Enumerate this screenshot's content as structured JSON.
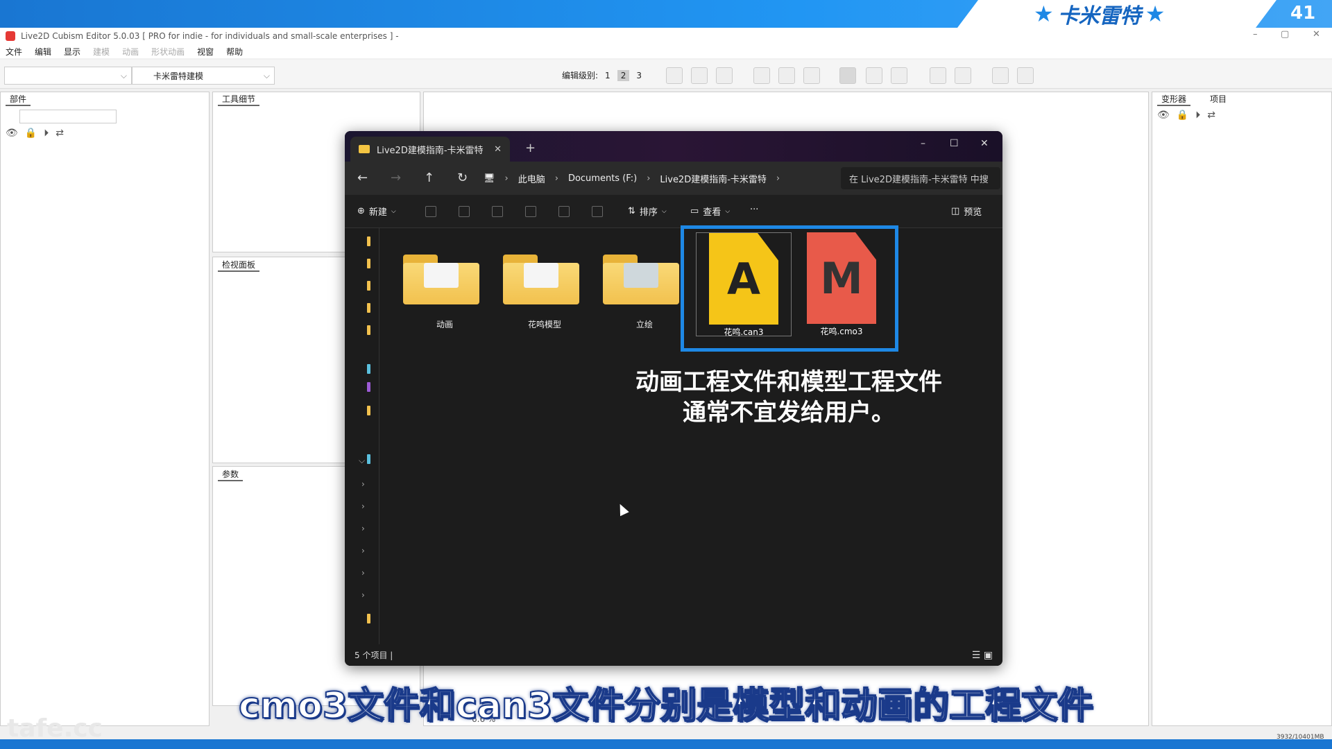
{
  "banner": {
    "brand": "卡米雷特",
    "star": "★",
    "episode": "41"
  },
  "titlebar": {
    "title": "Live2D Cubism Editor 5.0.03   [ PRO for indie - for individuals and small-scale enterprises ]  -",
    "minimize": "–",
    "maximize": "▢",
    "close": "✕"
  },
  "menu": {
    "file": "文件",
    "edit": "编辑",
    "view": "显示",
    "modeling": "建模",
    "animation": "动画",
    "form_anim": "形状动画",
    "window": "视窗",
    "help": "帮助"
  },
  "toolbar": {
    "workspace": "卡米雷特建模",
    "edit_level_label": "编辑级别:",
    "levels": [
      "1",
      "2",
      "3"
    ]
  },
  "panels": {
    "parts": "部件",
    "tool_detail": "工具细节",
    "inspector": "检视面板",
    "params": "参数",
    "deformer": "变形器",
    "project": "项目"
  },
  "explorer": {
    "tab_title": "Live2D建模指南-卡米雷特",
    "new_tab": "+",
    "path": [
      "此电脑",
      "Documents (F:)",
      "Live2D建模指南-卡米雷特"
    ],
    "search_placeholder": "在 Live2D建模指南-卡米雷特 中搜",
    "cmd_new": "新建",
    "cmd_sort": "排序",
    "cmd_view": "查看",
    "cmd_more": "···",
    "cmd_preview": "预览",
    "folders": [
      {
        "name": "动画"
      },
      {
        "name": "花鸣模型"
      },
      {
        "name": "立绘"
      }
    ],
    "files": [
      {
        "name": "花鸣.can3",
        "letter": "A"
      },
      {
        "name": "花鸣.cmo3",
        "letter": "M"
      }
    ],
    "note_line1": "动画工程文件和模型工程文件",
    "note_line2": "通常不宜发给用户。",
    "status": "5 个项目  |"
  },
  "zoom": "6.6 %",
  "subtitle": "cmo3文件和can3文件分别是模型和动画的工程文件",
  "watermark": "tafe.cc",
  "memory": "3932/10401MB",
  "colors": {
    "banner_blue": "#1976d2",
    "highlight": "#1e88e5",
    "can3_icon": "#f5c518",
    "cmo3_icon": "#e85a4a"
  }
}
